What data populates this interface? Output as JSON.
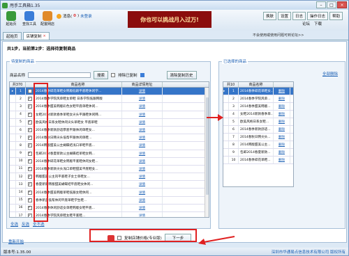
{
  "app": {
    "title": "甩手工具箱1.35"
  },
  "toolbar": {
    "items": [
      {
        "label": "起始页",
        "icon": "home-icon",
        "color": "#3a9a3a"
      },
      {
        "label": "查找工具",
        "icon": "search-tools-icon",
        "color": "#3b7dd8"
      },
      {
        "label": "配置网店",
        "icon": "shop-config-icon",
        "color": "#e08a2a"
      }
    ],
    "messages_label": "消息(",
    "messages_count": "0",
    "messages_close": ")",
    "not_logged_in": "未登录",
    "banner": "你也可以挑战月入过万!",
    "right_buttons": [
      "换肤",
      "设置",
      "日志",
      "操作日志",
      "帮助"
    ],
    "links": [
      "论坛",
      "下载"
    ],
    "notice": "不会使用或使用问题可到论坛>>"
  },
  "tabs": [
    {
      "label": "起始页",
      "active": false
    },
    {
      "label": "店铺复制",
      "active": true
    }
  ],
  "step": "共1步，当前第2步：选择待复制商品",
  "left": {
    "title": "待复制的商品",
    "filter_label": "商品名称",
    "search_btn": "搜索",
    "exclude_copied": "排除已复制",
    "clear_history": "清除复制历史",
    "columns": [
      "共370",
      "",
      "商品名称",
      "商品详情地址"
    ],
    "rows": [
      {
        "num": "1",
        "checked": true,
        "name": "2014春季碎花单鞋女韩版低跟平底鞋休闲学...",
        "detail": "详情",
        "selected": true
      },
      {
        "num": "2",
        "checked": true,
        "name": "2014春季学院风单鞋女单鞋 日系学院低跟韩版",
        "detail": "详情",
        "selected": false
      },
      {
        "num": "3",
        "checked": true,
        "name": "2014春季甜美韩版彩色女鞋平底单鞋休闲...",
        "detail": "详情",
        "selected": false
      },
      {
        "num": "4",
        "checked": true,
        "name": "女鞋2014新款春季单鞋女尖头平跟鞋休闲韩...",
        "detail": "详情",
        "selected": false
      },
      {
        "num": "5",
        "checked": true,
        "name": "欧美风格日系女鞋休闲尖头单鞋女 平底单鞋",
        "detail": "详情",
        "selected": false
      },
      {
        "num": "6",
        "checked": true,
        "name": "2014春季新款舒适厚底平跟休闲单鞋女...",
        "detail": "详情",
        "selected": false
      },
      {
        "num": "7",
        "checked": true,
        "name": "2014春秋日韩尖头低帮平跟休闲单鞋...",
        "detail": "详情",
        "selected": false
      },
      {
        "num": "8",
        "checked": true,
        "name": "2014韩版甜美公主蝴蝶结浅口单鞋平底...",
        "detail": "详情",
        "selected": false
      },
      {
        "num": "9",
        "checked": true,
        "name": "包邮2014春夏新款公主蝴蝶结单鞋女韩...",
        "detail": "详情",
        "selected": false
      },
      {
        "num": "10",
        "checked": true,
        "name": "2014春季碎花单鞋女韩版平底鞋休闲女鞋...",
        "detail": "详情",
        "selected": false
      },
      {
        "num": "11",
        "checked": true,
        "name": "2014春季新款尖头浅口单鞋甜美平底鞋女...",
        "detail": "详情",
        "selected": false
      },
      {
        "num": "12",
        "checked": true,
        "name": "韩版甜美公主风平底鞋子女士单鞋女...",
        "detail": "详情",
        "selected": false
      },
      {
        "num": "13",
        "checked": true,
        "name": "春夏新款韩版甜美蝴蝶结平底鞋女休闲...",
        "detail": "详情",
        "selected": false
      },
      {
        "num": "14",
        "checked": true,
        "name": "2014春季甜美韩版单鞋低跟女鞋休闲...",
        "detail": "详情",
        "selected": false
      },
      {
        "num": "15",
        "checked": true,
        "name": "春季新品低帮休闲平底单鞋学生鞋...",
        "detail": "详情",
        "selected": false
      },
      {
        "num": "16",
        "checked": true,
        "name": "2014春季休闲舒适女单鞋韩版女鞋平底...",
        "detail": "详情",
        "selected": false
      },
      {
        "num": "17",
        "checked": true,
        "name": "2014春季学院风单鞋女鞋平底鞋...",
        "detail": "详情",
        "selected": false
      }
    ],
    "select_all": "全选",
    "invert": "反选",
    "select_none": "全不选"
  },
  "right": {
    "title": "已选择的商品",
    "delete_all": "全部删除",
    "columns": [
      "共10",
      "商品名称",
      ""
    ],
    "rows": [
      {
        "num": "1",
        "name": "2014春季碎花单鞋女...",
        "del": "删除",
        "selected": true
      },
      {
        "num": "2",
        "name": "2014春季学院风单...",
        "del": "删除",
        "selected": false
      },
      {
        "num": "3",
        "name": "2014春季甜美韩版...",
        "del": "删除",
        "selected": false
      },
      {
        "num": "4",
        "name": "女鞋2014新款春季单...",
        "del": "删除",
        "selected": false
      },
      {
        "num": "5",
        "name": "欧美风格日系女鞋...",
        "del": "删除",
        "selected": false
      },
      {
        "num": "6",
        "name": "2014春季新款舒适...",
        "del": "删除",
        "selected": false
      },
      {
        "num": "7",
        "name": "2014春秋日韩尖头...",
        "del": "删除",
        "selected": false
      },
      {
        "num": "8",
        "name": "2014韩版甜美公主...",
        "del": "删除",
        "selected": false
      },
      {
        "num": "9",
        "name": "包邮2014春夏新款...",
        "del": "删除",
        "selected": false
      },
      {
        "num": "10",
        "name": "2014春季碎花单鞋...",
        "del": "删除",
        "selected": false
      }
    ]
  },
  "bottom": {
    "restart": "重新开始",
    "copy_sales": "复制店铺价格(专业版)",
    "next": "下一步"
  },
  "status": {
    "version": "版本号:1.35.00",
    "copyright": "深圳市华通易点信息技术有限公司 版权所有"
  },
  "colors": {
    "accent": "#1a5fb4",
    "selection": "#3575c8",
    "annotation": "#e02020",
    "banner": "#8b0d0d"
  }
}
